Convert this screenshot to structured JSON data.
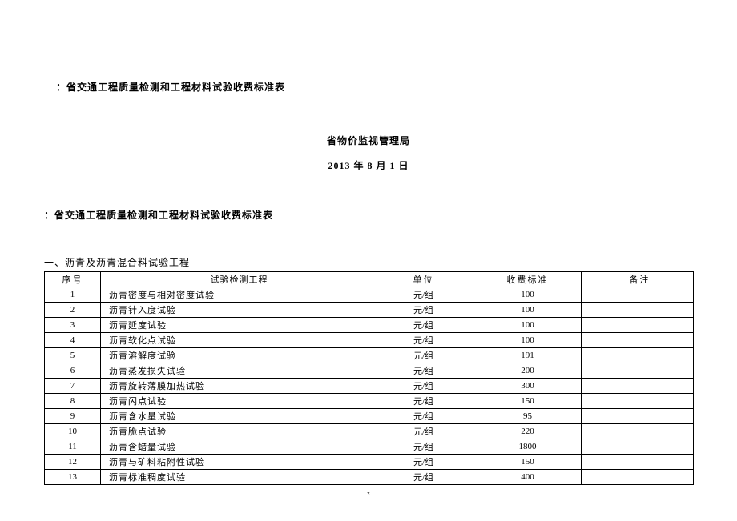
{
  "top_title": "：省交通工程质量检测和工程材料试验收费标准表",
  "issuer": "省物价监视管理局",
  "date": "2013 年 8 月 1 日",
  "second_title": "：省交通工程质量检测和工程材料试验收费标准表",
  "section_label": "一、沥青及沥青混合料试验工程",
  "headers": {
    "seq": "序号",
    "item": "试验检测工程",
    "unit": "单位",
    "fee": "收费标准",
    "remark": "备注"
  },
  "rows": [
    {
      "seq": "1",
      "item": "沥青密度与相对密度试验",
      "unit": "元/组",
      "fee": "100",
      "remark": ""
    },
    {
      "seq": "2",
      "item": "沥青针入度试验",
      "unit": "元/组",
      "fee": "100",
      "remark": ""
    },
    {
      "seq": "3",
      "item": "沥青延度试验",
      "unit": "元/组",
      "fee": "100",
      "remark": ""
    },
    {
      "seq": "4",
      "item": "沥青软化点试验",
      "unit": "元/组",
      "fee": "100",
      "remark": ""
    },
    {
      "seq": "5",
      "item": "沥青溶解度试验",
      "unit": "元/组",
      "fee": "191",
      "remark": ""
    },
    {
      "seq": "6",
      "item": "沥青蒸发损失试验",
      "unit": "元/组",
      "fee": "200",
      "remark": ""
    },
    {
      "seq": "7",
      "item": "沥青旋转薄膜加热试验",
      "unit": "元/组",
      "fee": "300",
      "remark": ""
    },
    {
      "seq": "8",
      "item": "沥青闪点试验",
      "unit": "元/组",
      "fee": "150",
      "remark": ""
    },
    {
      "seq": "9",
      "item": "沥青含水量试验",
      "unit": "元/组",
      "fee": "95",
      "remark": ""
    },
    {
      "seq": "10",
      "item": "沥青脆点试验",
      "unit": "元/组",
      "fee": "220",
      "remark": ""
    },
    {
      "seq": "11",
      "item": "沥青含蜡量试验",
      "unit": "元/组",
      "fee": "1800",
      "remark": ""
    },
    {
      "seq": "12",
      "item": "沥青与矿料粘附性试验",
      "unit": "元/组",
      "fee": "150",
      "remark": ""
    },
    {
      "seq": "13",
      "item": "沥青标准稠度试验",
      "unit": "元/组",
      "fee": "400",
      "remark": ""
    }
  ],
  "page_number": "z"
}
